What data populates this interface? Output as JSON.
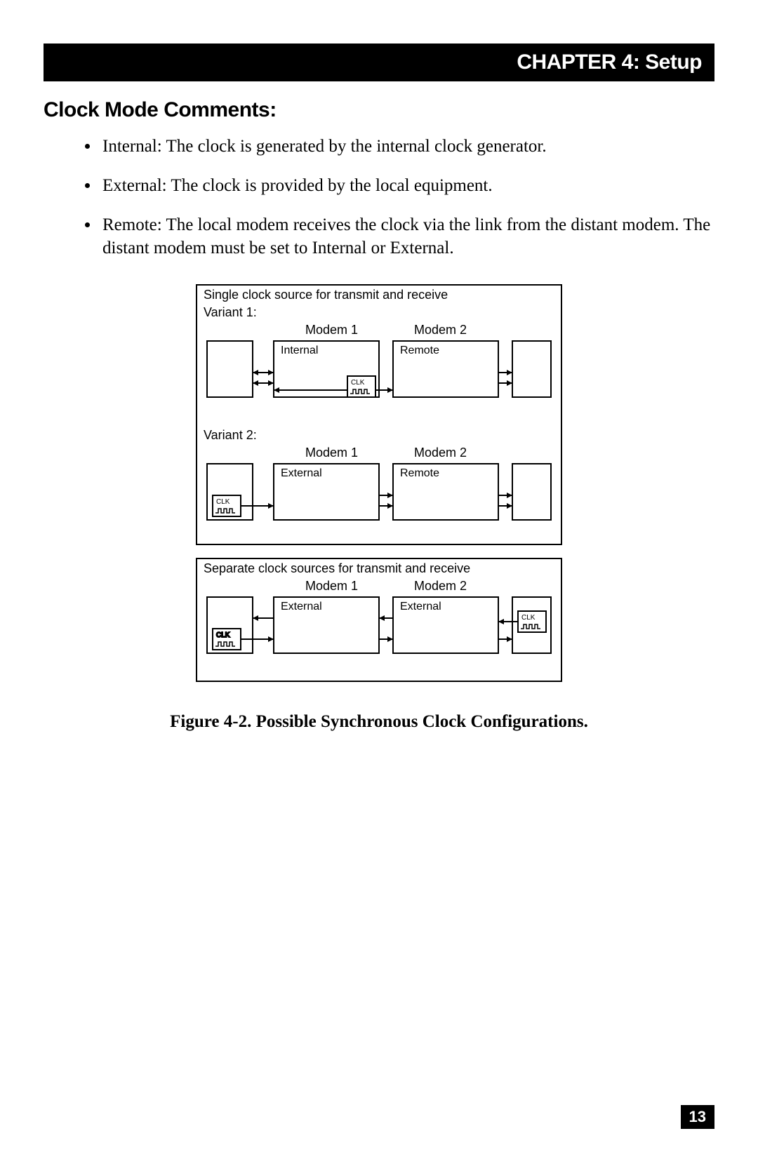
{
  "header": "CHAPTER 4: Setup",
  "section_title": "Clock Mode Comments:",
  "bullets": [
    "Internal: The clock is generated by the internal clock generator.",
    "External: The clock is provided by the local equipment.",
    "Remote: The local modem receives the clock via the link from the distant modem. The distant modem must be set to Internal or External."
  ],
  "figure_caption": "Figure 4-2. Possible Synchronous Clock Configurations.",
  "page_number": "13",
  "diagram": {
    "box1_title": "Single clock source for transmit and receive",
    "variant1": {
      "label": "Variant 1:",
      "modem1_label": "Modem 1",
      "modem1_mode": "Internal",
      "modem2_label": "Modem 2",
      "modem2_mode": "Remote"
    },
    "variant2": {
      "label": "Variant 2:",
      "modem1_label": "Modem 1",
      "modem1_mode": "External",
      "modem2_label": "Modem 2",
      "modem2_mode": "Remote"
    },
    "box2_title": "Separate clock sources for transmit and receive",
    "separate": {
      "modem1_label": "Modem 1",
      "modem1_mode": "External",
      "modem2_label": "Modem 2",
      "modem2_mode": "External"
    },
    "clk_label": "CLK"
  }
}
